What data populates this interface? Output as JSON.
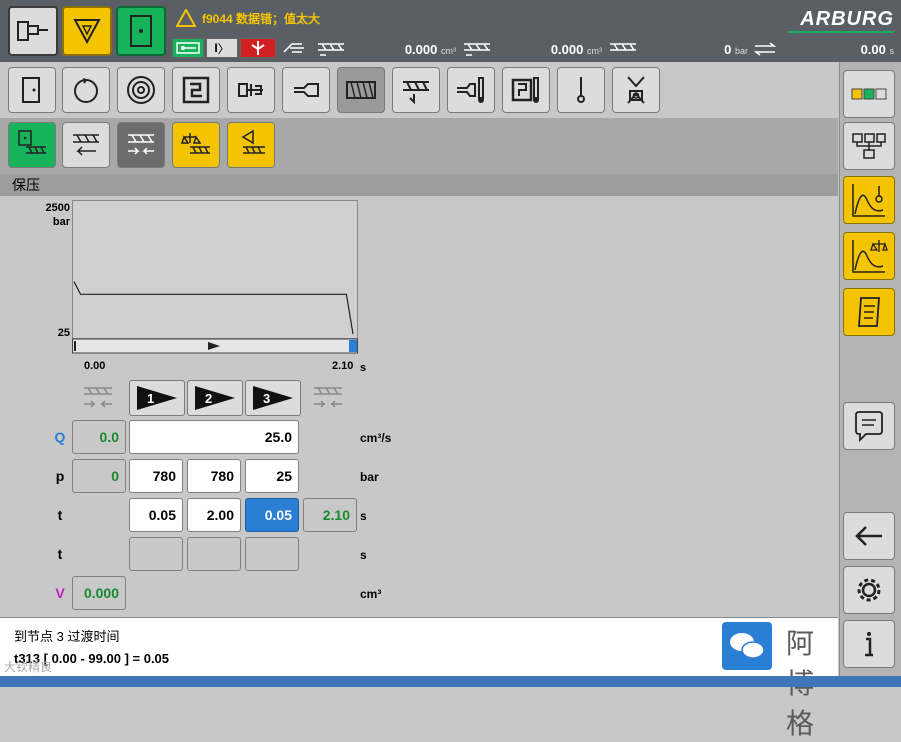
{
  "status": {
    "warning_text": "f9044 数据错；值太大",
    "brand": "ARBURG",
    "volume1": "0.000",
    "volume1_unit": "cm³",
    "volume2": "0.000",
    "volume2_unit": "cm³",
    "pressure": "0",
    "pressure_unit": "bar",
    "time": "0.00",
    "time_unit": "s",
    "mode_label": "I"
  },
  "section": {
    "title": "保压"
  },
  "chart_data": {
    "type": "line",
    "title": "",
    "y_top_label": "2500",
    "y_unit": "bar",
    "y_bottom_label": "25",
    "x_start_label": "0.00",
    "x_end_label": "2.10",
    "x_unit": "s",
    "xlim": [
      0,
      2.1
    ],
    "ylim": [
      25,
      2500
    ],
    "x": [
      0,
      0.05,
      2.05,
      2.1
    ],
    "y": [
      780,
      780,
      780,
      25
    ]
  },
  "stages": [
    "1",
    "2",
    "3"
  ],
  "rows": {
    "Q": {
      "label": "Q",
      "indicator": "0.0",
      "value": "25.0",
      "unit": "cm³/s"
    },
    "p": {
      "label": "p",
      "indicator": "0",
      "values": [
        "780",
        "780",
        "25"
      ],
      "unit": "bar"
    },
    "t": {
      "label": "t",
      "values": [
        "0.05",
        "2.00",
        "0.05"
      ],
      "total": "2.10",
      "unit": "s"
    },
    "t2": {
      "label": "t",
      "unit": "s"
    },
    "V": {
      "label": "V",
      "indicator": "0.000",
      "unit": "cm³"
    }
  },
  "footer": {
    "line1": "到节点 3 过渡时间",
    "line2": "t313 [ 0.00 - 99.00 ] = 0.05"
  },
  "watermark": {
    "text": "阿博格",
    "corner": "大钦精良"
  },
  "colors": {
    "accent_yellow": "#f5c400",
    "accent_green": "#17b35a",
    "selected_blue": "#2a7fd4",
    "value_green": "#178a2f"
  }
}
